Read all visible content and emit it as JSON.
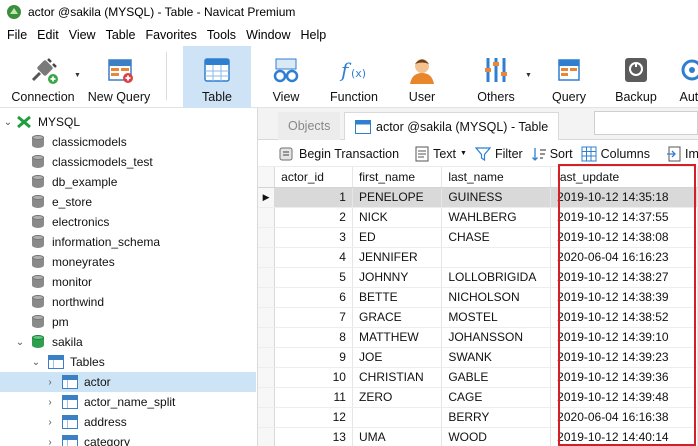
{
  "window": {
    "title": "actor @sakila (MYSQL) - Table - Navicat Premium"
  },
  "menu": [
    "File",
    "Edit",
    "View",
    "Table",
    "Favorites",
    "Tools",
    "Window",
    "Help"
  ],
  "toolbar": {
    "connection": "Connection",
    "new_query": "New Query",
    "table": "Table",
    "view": "View",
    "function": "Function",
    "user": "User",
    "others": "Others",
    "query": "Query",
    "backup": "Backup",
    "automation": "Autc"
  },
  "nav": {
    "connection": "MYSQL",
    "databases": [
      "classicmodels",
      "classicmodels_test",
      "db_example",
      "e_store",
      "electronics",
      "information_schema",
      "moneyrates",
      "monitor",
      "northwind",
      "pm"
    ],
    "open_db": "sakila",
    "tables_folder": "Tables",
    "tables": [
      "actor",
      "actor_name_split",
      "address",
      "category"
    ]
  },
  "tabs": {
    "objects": "Objects",
    "active": "actor @sakila (MYSQL) - Table"
  },
  "subtoolbar": {
    "begin_transaction": "Begin Transaction",
    "text": "Text",
    "filter": "Filter",
    "sort": "Sort",
    "columns": "Columns",
    "import": "Im"
  },
  "grid": {
    "columns": [
      "actor_id",
      "first_name",
      "last_name",
      "last_update"
    ],
    "rows": [
      [
        "1",
        "PENELOPE",
        "GUINESS",
        "2019-10-12 14:35:18"
      ],
      [
        "2",
        "NICK",
        "WAHLBERG",
        "2019-10-12 14:37:55"
      ],
      [
        "3",
        "ED",
        "CHASE",
        "2019-10-12 14:38:08"
      ],
      [
        "4",
        "JENNIFER",
        "",
        "2020-06-04 16:16:23"
      ],
      [
        "5",
        "JOHNNY",
        "LOLLOBRIGIDA",
        "2019-10-12 14:38:27"
      ],
      [
        "6",
        "BETTE",
        "NICHOLSON",
        "2019-10-12 14:38:39"
      ],
      [
        "7",
        "GRACE",
        "MOSTEL",
        "2019-10-12 14:38:52"
      ],
      [
        "8",
        "MATTHEW",
        "JOHANSSON",
        "2019-10-12 14:39:10"
      ],
      [
        "9",
        "JOE",
        "SWANK",
        "2019-10-12 14:39:23"
      ],
      [
        "10",
        "CHRISTIAN",
        "GABLE",
        "2019-10-12 14:39:36"
      ],
      [
        "11",
        "ZERO",
        "CAGE",
        "2019-10-12 14:39:48"
      ],
      [
        "12",
        "",
        "BERRY",
        "2020-06-04 16:16:38"
      ],
      [
        "13",
        "UMA",
        "WOOD",
        "2019-10-12 14:40:14"
      ]
    ],
    "current_row_marker": "▶"
  },
  "colors": {
    "highlight": "#d32026",
    "selection": "#cde4f7",
    "toolbar_active": "#cfe3f6"
  }
}
